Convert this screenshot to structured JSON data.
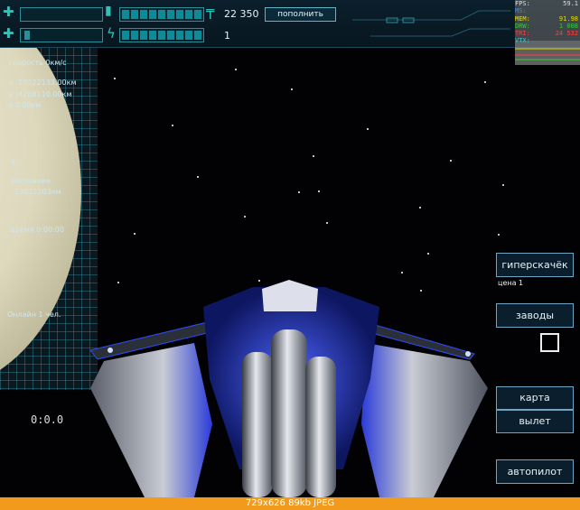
{
  "hud": {
    "credits": "22 350",
    "currency_icon": "tenge-icon",
    "refill_label": "пополнить",
    "energy_value": "1"
  },
  "stats": [
    {
      "key": "FPS:",
      "value": "59.1",
      "color": "#e0e0e0"
    },
    {
      "key": "MS:",
      "value": "",
      "color": "#2f8fff"
    },
    {
      "key": "MEM:",
      "value": "91.98",
      "color": "#e0e000"
    },
    {
      "key": "DRW:",
      "value": "1 008",
      "color": "#30d030"
    },
    {
      "key": "TRI:",
      "value": "24 532",
      "color": "#ff4040"
    },
    {
      "key": "VTX:",
      "value": "",
      "color": "#30d0d0"
    }
  ],
  "nav": {
    "speed": "скорость 0км/с",
    "x": "x -13222133.00км",
    "y": "y -4268110.00км",
    "z": "z 0.00км",
    "g": "g",
    "distance_label": "растояние",
    "distance_value": "23611103км",
    "time_label": "время 0:00:00",
    "online": "Онлайн 1 чел."
  },
  "game_time": "0:0.0",
  "buttons": {
    "hyperjump": "гиперскачёк",
    "hyperjump_price": "цена 1",
    "factories": "заводы",
    "map": "карта",
    "departure": "вылет",
    "autopilot": "автопилот"
  },
  "footer": "729x626  89kb  JPEG"
}
